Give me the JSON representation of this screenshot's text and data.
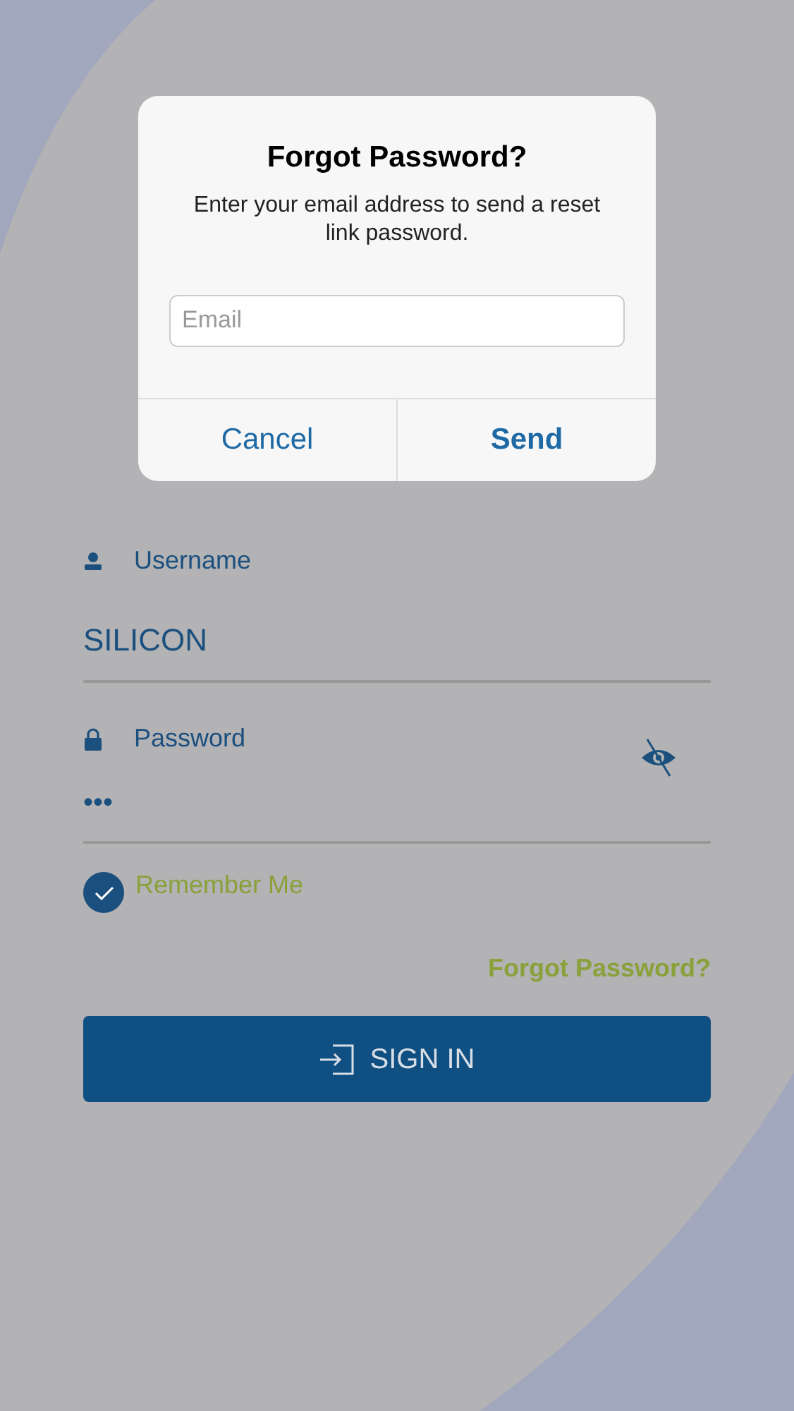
{
  "dialog": {
    "title": "Forgot Password?",
    "message": "Enter your email address to send a reset link password.",
    "email": {
      "placeholder": "Email"
    },
    "buttons": [
      {
        "label": "Cancel",
        "kind": "cancel"
      },
      {
        "label": "Send",
        "kind": "primary"
      }
    ]
  },
  "form": {
    "username": {
      "label": "Username",
      "value": "SILICON"
    },
    "password": {
      "label": "Password",
      "value": "•••",
      "visible": false
    },
    "remember": {
      "label": "Remember Me",
      "checked": true
    },
    "forgot_link": "Forgot Password?",
    "sign_in": "SIGN IN"
  }
}
